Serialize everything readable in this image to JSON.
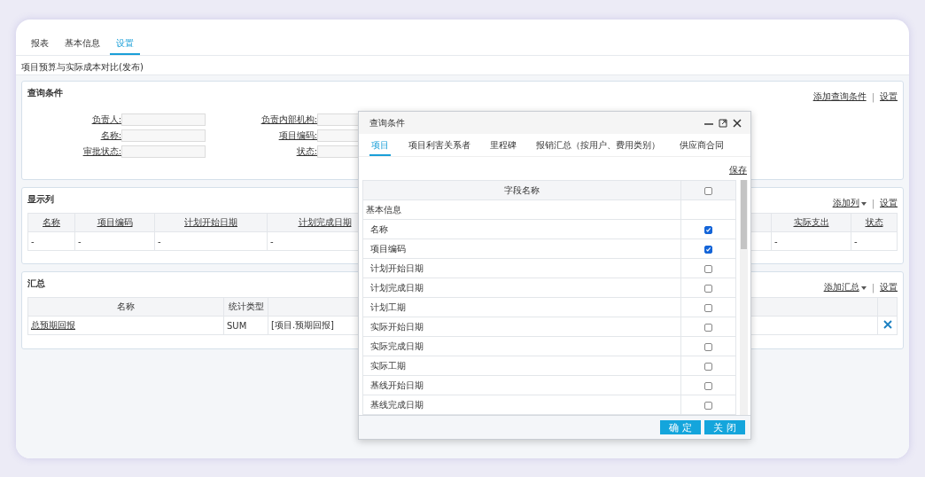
{
  "tabs": [
    {
      "label": "报表",
      "selected": false
    },
    {
      "label": "基本信息",
      "selected": false
    },
    {
      "label": "设置",
      "selected": true
    }
  ],
  "report_title": "项目预算与实际成本对比(发布)",
  "query_panel": {
    "title": "查询条件",
    "separator": "|",
    "actions": [
      {
        "label": "添加查询条件",
        "dropdown": false
      },
      {
        "label": "设置",
        "dropdown": false
      }
    ],
    "fields": [
      {
        "label": "负责人:"
      },
      {
        "label": "负责内部机构:"
      },
      {
        "label": "名称:"
      },
      {
        "label": "项目编码:"
      },
      {
        "label": "审批状态:"
      },
      {
        "label": "状态:"
      }
    ]
  },
  "columns_panel": {
    "title": "显示列",
    "separator": "|",
    "actions": [
      {
        "label": "添加列",
        "dropdown": true
      },
      {
        "label": "设置",
        "dropdown": false
      }
    ],
    "columns": [
      "名称",
      "项目编码",
      "计划开始日期",
      "计划完成日期",
      "实际支出",
      "状态"
    ],
    "rows": [
      [
        "-",
        "-",
        "-",
        "-",
        "-",
        "-"
      ]
    ]
  },
  "summary_panel": {
    "title": "汇总",
    "separator": "|",
    "actions": [
      {
        "label": "添加汇总",
        "dropdown": true
      },
      {
        "label": "设置",
        "dropdown": false
      }
    ],
    "columns": [
      "名称",
      "统计类型"
    ],
    "rows": [
      {
        "name": "总预期回报",
        "type": "SUM",
        "expression": "[项目.预期回报]"
      }
    ]
  },
  "dialog": {
    "title": "查询条件",
    "tabs": [
      {
        "label": "项目",
        "selected": true
      },
      {
        "label": "项目利害关系者",
        "selected": false
      },
      {
        "label": "里程碑",
        "selected": false
      },
      {
        "label": "报销汇总（按用户、费用类别）",
        "selected": false
      },
      {
        "label": "供应商合同",
        "selected": false
      }
    ],
    "save": "保存",
    "header": "字段名称",
    "header_checked": false,
    "rows": [
      {
        "kind": "group",
        "label": "基本信息"
      },
      {
        "kind": "field",
        "label": "名称",
        "checked": true
      },
      {
        "kind": "field",
        "label": "项目编码",
        "checked": true
      },
      {
        "kind": "field",
        "label": "计划开始日期",
        "checked": false
      },
      {
        "kind": "field",
        "label": "计划完成日期",
        "checked": false
      },
      {
        "kind": "field",
        "label": "计划工期",
        "checked": false
      },
      {
        "kind": "field",
        "label": "实际开始日期",
        "checked": false
      },
      {
        "kind": "field",
        "label": "实际完成日期",
        "checked": false
      },
      {
        "kind": "field",
        "label": "实际工期",
        "checked": false
      },
      {
        "kind": "field",
        "label": "基线开始日期",
        "checked": false
      },
      {
        "kind": "field",
        "label": "基线完成日期",
        "checked": false
      }
    ],
    "buttons": [
      "确 定",
      "关 闭"
    ]
  }
}
